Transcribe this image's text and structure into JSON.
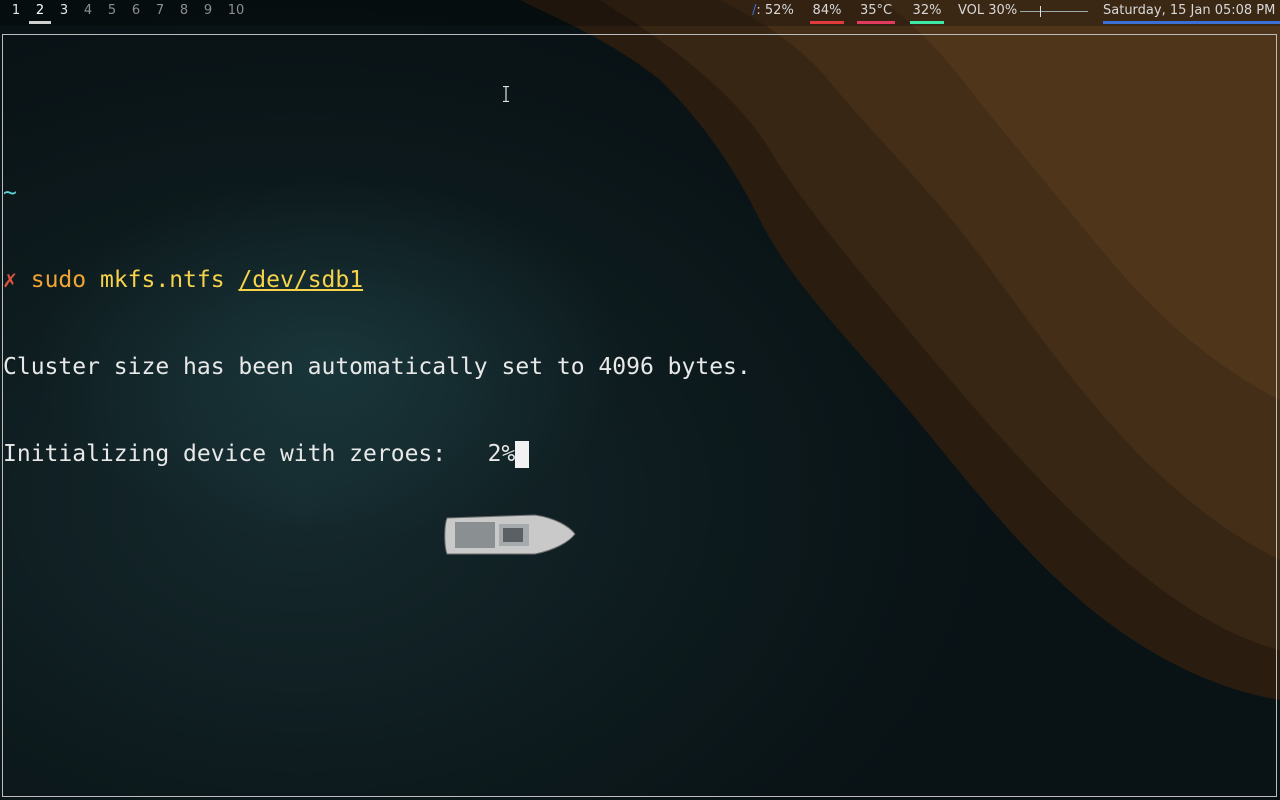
{
  "colors": {
    "accent_date": "#3b6fd6",
    "cpu_underline": "#e23b3b",
    "temp_underline": "#e23b5b",
    "mem_underline": "#3ee8a5",
    "prompt_cross": "#e0523b",
    "command": "#f0a533",
    "argument": "#f6d34a",
    "tilde": "#5fd3d9"
  },
  "workspaces": [
    {
      "label": "1",
      "state": "occupied"
    },
    {
      "label": "2",
      "state": "active"
    },
    {
      "label": "3",
      "state": "occupied"
    },
    {
      "label": "4",
      "state": "empty"
    },
    {
      "label": "5",
      "state": "empty"
    },
    {
      "label": "6",
      "state": "empty"
    },
    {
      "label": "7",
      "state": "empty"
    },
    {
      "label": "8",
      "state": "empty"
    },
    {
      "label": "9",
      "state": "empty"
    },
    {
      "label": "10",
      "state": "empty"
    }
  ],
  "status": {
    "disk_icon_glyph": "/",
    "disk_text": ": 52%",
    "cpu": "84%",
    "temp": "35°C",
    "mem": "32%",
    "volume_label": "VOL 30%",
    "volume_level": 0.3,
    "datetime": "Saturday, 15 Jan 05:08 PM"
  },
  "terminal": {
    "cwd": "~",
    "prompt_symbol": "✗",
    "command": "sudo",
    "subcommand": "mkfs.ntfs",
    "argument": "/dev/sdb1",
    "output_line1": "Cluster size has been automatically set to 4096 bytes.",
    "output_line2": "Initializing device with zeroes:   2%"
  }
}
